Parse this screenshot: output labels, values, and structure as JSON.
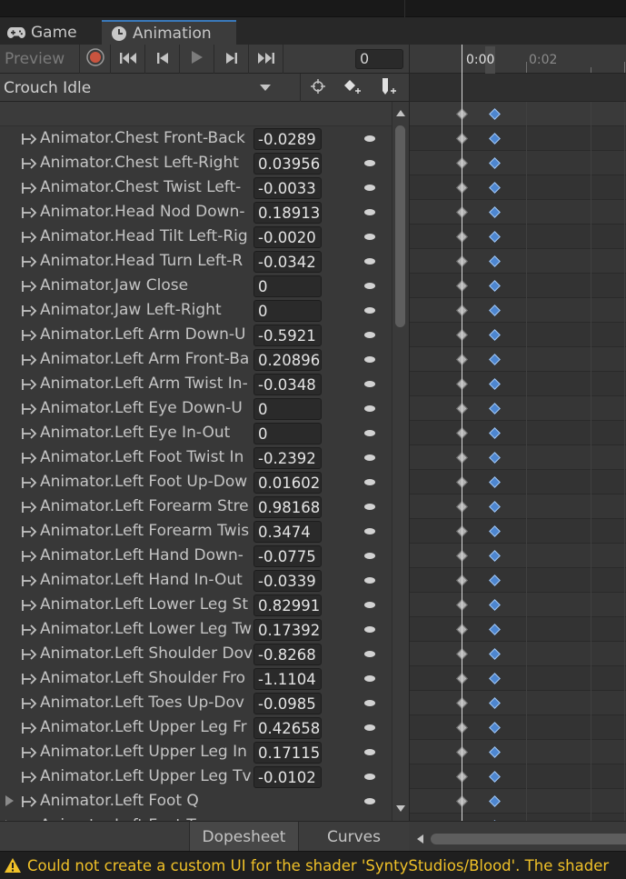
{
  "tabs": {
    "game_label": "Game",
    "animation_label": "Animation"
  },
  "controls": {
    "preview_label": "Preview",
    "frame_value": "0"
  },
  "clip": {
    "name": "Crouch Idle"
  },
  "properties": [
    {
      "label": "Animator.Chest Front-Back",
      "value": "-0.0289"
    },
    {
      "label": "Animator.Chest Left-Right",
      "value": "0.03956"
    },
    {
      "label": "Animator.Chest Twist Left-",
      "value": "-0.0033"
    },
    {
      "label": "Animator.Head Nod Down-",
      "value": "0.18913"
    },
    {
      "label": "Animator.Head Tilt Left-Rig",
      "value": "-0.0020"
    },
    {
      "label": "Animator.Head Turn Left-R",
      "value": "-0.0342"
    },
    {
      "label": "Animator.Jaw Close",
      "value": "0"
    },
    {
      "label": "Animator.Jaw Left-Right",
      "value": "0"
    },
    {
      "label": "Animator.Left Arm Down-U",
      "value": "-0.5921"
    },
    {
      "label": "Animator.Left Arm Front-Ba",
      "value": "0.20896"
    },
    {
      "label": "Animator.Left Arm Twist In-",
      "value": "-0.0348"
    },
    {
      "label": "Animator.Left Eye Down-U",
      "value": "0"
    },
    {
      "label": "Animator.Left Eye In-Out",
      "value": "0"
    },
    {
      "label": "Animator.Left Foot Twist In",
      "value": "-0.2392"
    },
    {
      "label": "Animator.Left Foot Up-Dow",
      "value": "0.01602"
    },
    {
      "label": "Animator.Left Forearm Stre",
      "value": "0.98168"
    },
    {
      "label": "Animator.Left Forearm Twis",
      "value": "0.3474"
    },
    {
      "label": "Animator.Left Hand Down-",
      "value": "-0.0775"
    },
    {
      "label": "Animator.Left Hand In-Out",
      "value": "-0.0339"
    },
    {
      "label": "Animator.Left Lower Leg St",
      "value": "0.82991"
    },
    {
      "label": "Animator.Left Lower Leg Tw",
      "value": "0.17392"
    },
    {
      "label": "Animator.Left Shoulder Dov",
      "value": "-0.8268"
    },
    {
      "label": "Animator.Left Shoulder Fro",
      "value": "-1.1104"
    },
    {
      "label": "Animator.Left Toes Up-Dov",
      "value": "-0.0985"
    },
    {
      "label": "Animator.Left Upper Leg Fr",
      "value": "0.42658"
    },
    {
      "label": "Animator.Left Upper Leg In",
      "value": "0.17115"
    },
    {
      "label": "Animator.Left Upper Leg Tv",
      "value": "-0.0102"
    },
    {
      "label": "Animator.Left Foot Q",
      "value": ""
    },
    {
      "label": "Animator.Left Foot T",
      "value": ""
    }
  ],
  "timeline": {
    "ruler_labels": [
      "0:00",
      "0:02"
    ]
  },
  "bottom_tabs": {
    "dopesheet_label": "Dopesheet",
    "curves_label": "Curves"
  },
  "console": {
    "message": "Could not create a custom UI for the shader 'SyntyStudios/Blood'. The shader"
  },
  "colors": {
    "accent": "#3a79bb",
    "key_selected": "#4d86d0",
    "key_normal": "#b4b4b4",
    "warning": "#f0c128"
  },
  "icons": [
    "gamepad-icon",
    "clock-icon",
    "record-icon",
    "first-key-icon",
    "prev-key-icon",
    "play-icon",
    "next-key-icon",
    "last-key-icon",
    "filter-icon",
    "add-keyframe-icon",
    "add-event-icon",
    "property-icon",
    "visibility-dot-icon",
    "warning-icon"
  ]
}
